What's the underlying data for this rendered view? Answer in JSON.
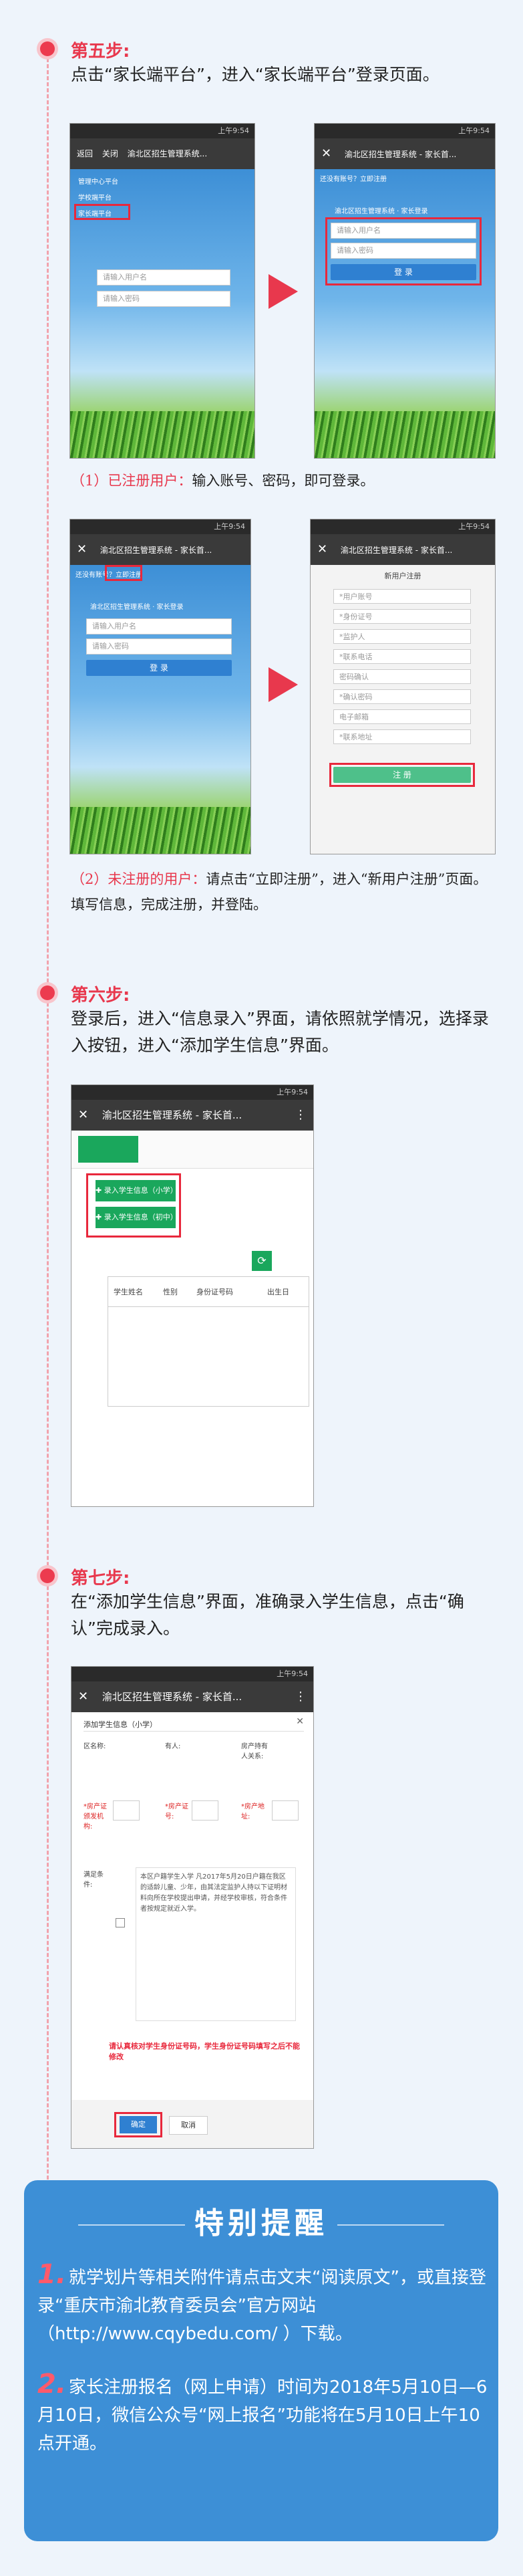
{
  "step5": {
    "title": "第五步:",
    "desc": "点击“家长端平台”，进入“家长端平台”登录页面。",
    "note1_label": "（1）已注册用户：",
    "note1_text": "输入账号、密码，即可登录。",
    "note2_label": "（2）未注册的用户：",
    "note2_text": "请点击“立即注册”，进入“新用户注册”页面。填写信息，完成注册，并登陆。"
  },
  "step6": {
    "title": "第六步:",
    "desc": "登录后，进入“信息录入”界面，请依照就学情况，选择录入按钮，进入“添加学生信息”界面。"
  },
  "step7": {
    "title": "第七步:",
    "desc": "在“添加学生信息”界面，准确录入学生信息，点击“确认”完成录入。"
  },
  "screens": {
    "app_title": "渝北区招生管理系统 - 家长首...",
    "app_title_short": "渝北区招生管理系统...",
    "back_label": "返回",
    "close_label": "关闭",
    "status_time": "上午9:54",
    "menu_items": [
      "家长端平台",
      "学校端平台",
      "管理中心平台"
    ],
    "login_heading": "渝北区招生管理系统 · 家长登录",
    "register_prompt": "还没有账号？立即注册",
    "username_placeholder": "请输入用户名",
    "password_placeholder": "请输入密码",
    "login_button": "登 录",
    "register_title": "新用户注册",
    "register_fields": [
      "*用户账号",
      "*身份证号",
      "*监护人",
      "*联系电话",
      "密码确认",
      "*确认密码",
      "电子邮箱",
      "*联系地址"
    ],
    "register_button": "注 册",
    "add_primary": "✚ 录入学生信息（小学）",
    "add_middle": "✚ 录入学生信息（初中）",
    "table_headers": [
      "学生姓名",
      "性别",
      "身份证号码",
      "出生日"
    ],
    "form_title": "添加学生信息（小学）",
    "form_labels": [
      "区名称:",
      "有人:",
      "房产持有人关系:",
      "*房产证颁发机构:",
      "*房产证号:",
      "*房产地址:",
      "满足条件:"
    ],
    "form_condition": "本区户籍学生入学 凡2017年5月20日户籍在我区的适龄儿童、少年，由其法定监护人持以下证明材料向所在学校提出申请，并经学校审核，符合条件者按规定就近入学。",
    "form_warning": "请认真核对学生身份证号码，学生身份证号码填写之后不能修改",
    "confirm_button": "确定",
    "cancel_button": "取消"
  },
  "reminder": {
    "title": "特别提醒",
    "item1_num": "1.",
    "item1_text": "就学划片等相关附件请点击文末“阅读原文”，或直接登录“重庆市渝北教育委员会”官方网站（http://www.cqybedu.com/ ）下载。",
    "item2_num": "2.",
    "item2_text": "家长注册报名（网上申请）时间为2018年5月10日—6月10日，微信公众号“网上报名”功能将在5月10日上午10点开通。"
  },
  "colors": {
    "accent_red": "#e8384d",
    "reminder_blue": "#3d8fd6",
    "button_green": "#1aa75c"
  }
}
